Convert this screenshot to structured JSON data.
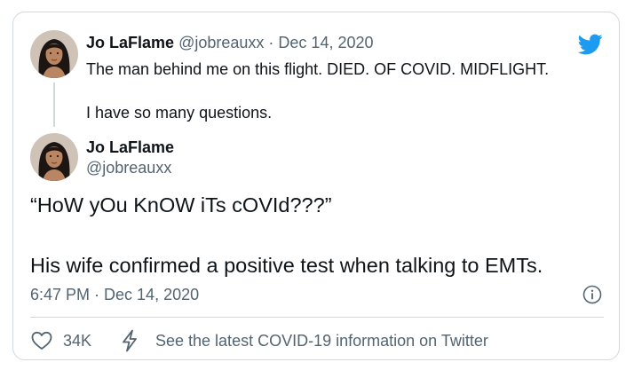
{
  "colors": {
    "text": "#0f1419",
    "muted": "#536471",
    "border": "#cfd9de",
    "twitter_blue": "#1d9bf0"
  },
  "icons": {
    "brand": "twitter-bird-icon",
    "info": "info-icon",
    "like": "heart-icon",
    "covid_info": "lightning-bolt-icon"
  },
  "reply_tweet": {
    "author_name": "Jo LaFlame",
    "handle": "@jobreauxx",
    "separator": "·",
    "date": "Dec 14, 2020",
    "line1": "The man behind me on this flight. DIED. OF COVID. MIDFLIGHT.",
    "line2": "I have so many questions."
  },
  "main_tweet": {
    "author_name": "Jo LaFlame",
    "handle": "@jobreauxx",
    "line1": "“HoW yOu KnOW iTs cOVId???”",
    "line2": "His wife confirmed a positive test when talking to EMTs.",
    "timestamp": "6:47 PM · Dec 14, 2020"
  },
  "actions": {
    "like_count": "34K",
    "covid_link": "See the latest COVID-19 information on Twitter"
  }
}
